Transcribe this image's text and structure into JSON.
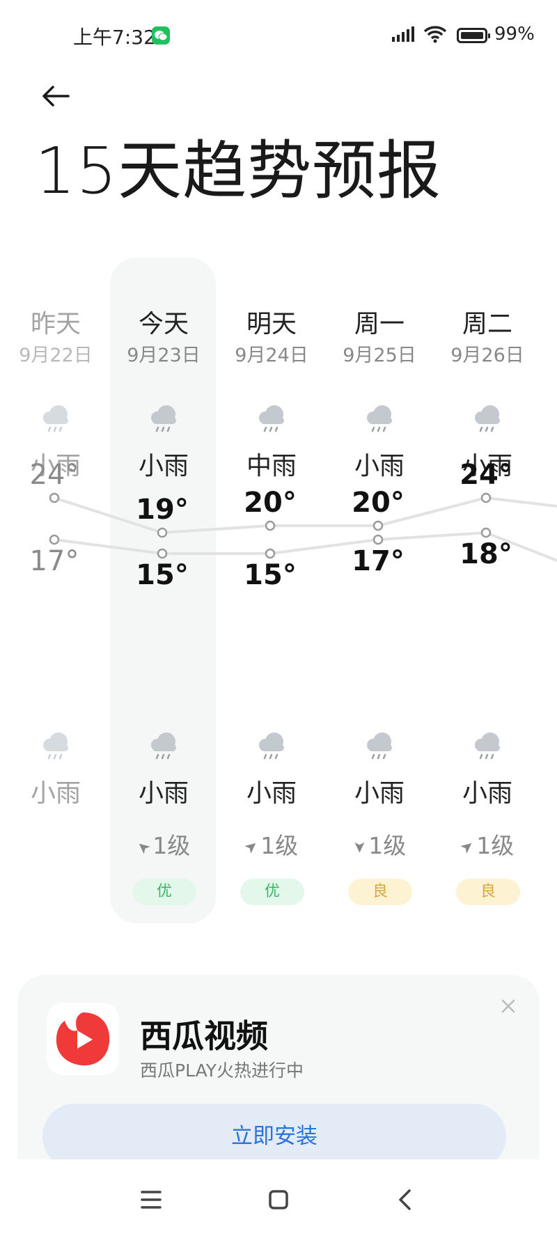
{
  "status_bar": {
    "time": "上午7:32",
    "battery": "99%"
  },
  "page_title": "15天趋势预报",
  "days": [
    {
      "name": "昨天",
      "date": "9月22日",
      "day_weather": "小雨",
      "high": "24°",
      "low": "17°",
      "night_weather": "小雨",
      "wind": "",
      "aqi": "",
      "past": true
    },
    {
      "name": "今天",
      "date": "9月23日",
      "day_weather": "小雨",
      "high": "19°",
      "low": "15°",
      "night_weather": "小雨",
      "wind": "1级",
      "aqi": "优"
    },
    {
      "name": "明天",
      "date": "9月24日",
      "day_weather": "中雨",
      "high": "20°",
      "low": "15°",
      "night_weather": "小雨",
      "wind": "1级",
      "aqi": "优"
    },
    {
      "name": "周一",
      "date": "9月25日",
      "day_weather": "小雨",
      "high": "20°",
      "low": "17°",
      "night_weather": "小雨",
      "wind": "1级",
      "aqi": "良"
    },
    {
      "name": "周二",
      "date": "9月26日",
      "day_weather": "小雨",
      "high": "24°",
      "low": "18°",
      "night_weather": "小雨",
      "wind": "1级",
      "aqi": "良"
    }
  ],
  "high_temps": [
    24,
    19,
    20,
    20,
    24
  ],
  "low_temps": [
    17,
    15,
    15,
    17,
    18
  ],
  "ad": {
    "title": "西瓜视频",
    "subtitle": "西瓜PLAY火热进行中",
    "button": "立即安装"
  },
  "colors": {
    "good": "#3cb46a",
    "ok": "#d9a534",
    "accent": "#2a73d9"
  },
  "icons": [
    "back-arrow-icon",
    "rain-cloud-icon",
    "close-icon",
    "menu-icon",
    "home-icon",
    "back-icon"
  ]
}
